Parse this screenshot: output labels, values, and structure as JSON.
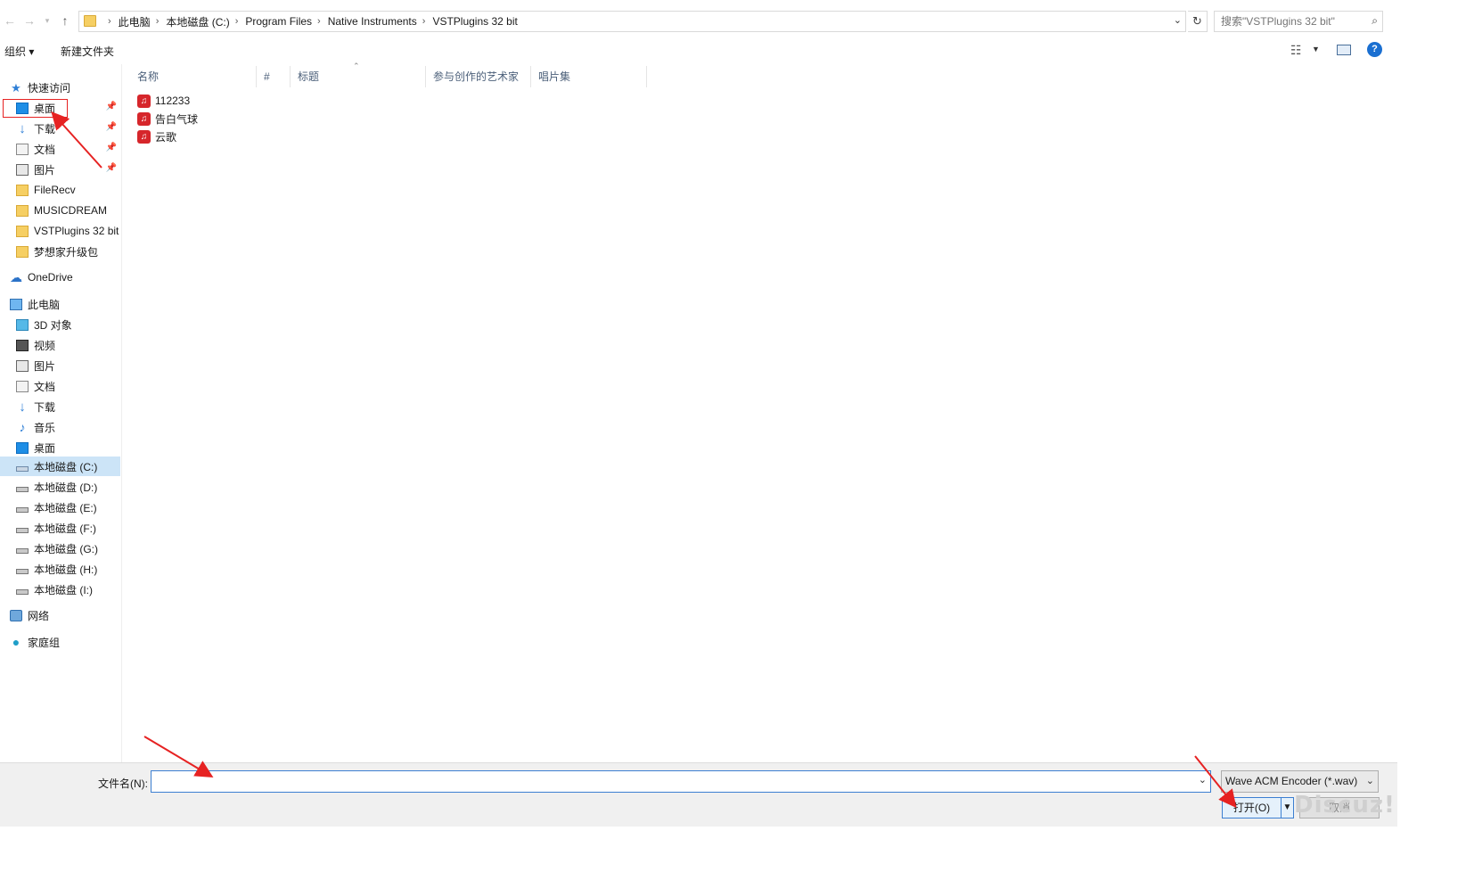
{
  "address_bar": {
    "breadcrumbs": [
      "此电脑",
      "本地磁盘 (C:)",
      "Program Files",
      "Native Instruments",
      "VSTPlugins 32 bit"
    ],
    "search_placeholder": "搜索\"VSTPlugins 32 bit\""
  },
  "toolbar": {
    "organize_label": "组织 ▾",
    "new_folder_label": "新建文件夹"
  },
  "nav": {
    "quick_access": "快速访问",
    "quick_items": [
      "桌面",
      "下载",
      "文档",
      "图片",
      "FileRecv",
      "MUSICDREAM",
      "VSTPlugins 32 bit",
      "梦想家升级包"
    ],
    "onedrive": "OneDrive",
    "this_pc": "此电脑",
    "pc_items": [
      "3D 对象",
      "视频",
      "图片",
      "文档",
      "下载",
      "音乐",
      "桌面"
    ],
    "drives": [
      "本地磁盘 (C:)",
      "本地磁盘 (D:)",
      "本地磁盘 (E:)",
      "本地磁盘 (F:)",
      "本地磁盘 (G:)",
      "本地磁盘 (H:)",
      "本地磁盘 (I:)"
    ],
    "network": "网络",
    "homegroup": "家庭组"
  },
  "columns": [
    "名称",
    "#",
    "标题",
    "参与创作的艺术家",
    "唱片集"
  ],
  "files": [
    {
      "name": "112233"
    },
    {
      "name": "告白气球"
    },
    {
      "name": "云歌"
    }
  ],
  "bottom": {
    "filename_label": "文件名(N):",
    "filename_value": "",
    "file_type": "Wave ACM Encoder (*.wav)",
    "open_label": "打开(O)",
    "cancel_label": "取消"
  },
  "watermark": "Discuz!",
  "colors": {
    "selection": "#cce4f7",
    "accent_blue": "#3c7fd1",
    "annotation_red": "#e62222",
    "file_icon_red": "#d6262b"
  }
}
